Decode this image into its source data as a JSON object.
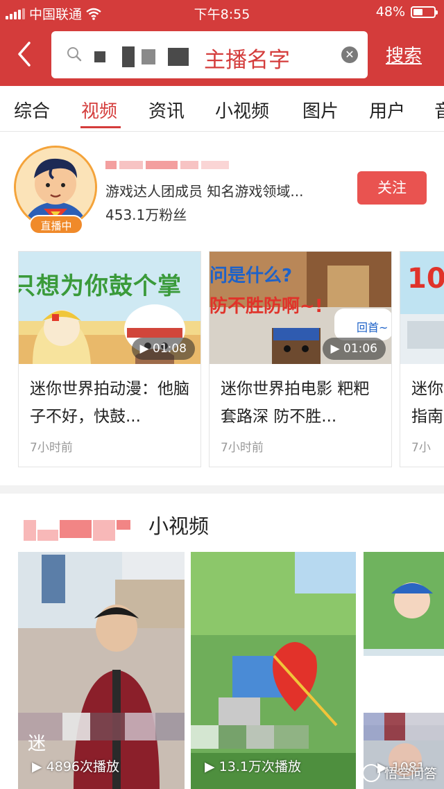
{
  "status": {
    "carrier": "中国联通",
    "time": "下午8:55",
    "battery": "48%",
    "battery_level": 0.48
  },
  "header": {
    "query": "主播名字",
    "search_label": "搜索"
  },
  "tabs": [
    {
      "label": "综合"
    },
    {
      "label": "视频"
    },
    {
      "label": "资讯"
    },
    {
      "label": "小视频"
    },
    {
      "label": "图片"
    },
    {
      "label": "用户"
    },
    {
      "label": "音"
    }
  ],
  "active_tab": "视频",
  "user": {
    "live_badge": "直播中",
    "description": "游戏达人团成员 知名游戏领域...",
    "fans": "453.1万粉丝",
    "follow_label": "关注"
  },
  "videos": [
    {
      "duration": "01:08",
      "title": "迷你世界拍动漫：他脑子不好，快鼓...",
      "time": "7小时前",
      "thumb_text": "只想为你鼓个掌"
    },
    {
      "duration": "01:06",
      "title": "迷你世界拍电影 粑粑套路深 防不胜...",
      "time": "7小时前",
      "thumb_text_1": "问是什么?",
      "thumb_text_2": "防不胜防啊~!",
      "thumb_text_3": "回首~"
    },
    {
      "title": "迷你指南",
      "time": "7小",
      "thumb_text": "10"
    }
  ],
  "small_video": {
    "section_title": "小视频",
    "items": [
      {
        "caption_prefix": "迷",
        "plays": "4896次播放"
      },
      {
        "plays": "13.1万次播放"
      },
      {
        "plays": "1081"
      }
    ]
  },
  "watermark": "悟空问答",
  "colors": {
    "brand_red": "#d43c3b",
    "live_orange": "#f08a2a",
    "follow_red": "#e95350"
  }
}
